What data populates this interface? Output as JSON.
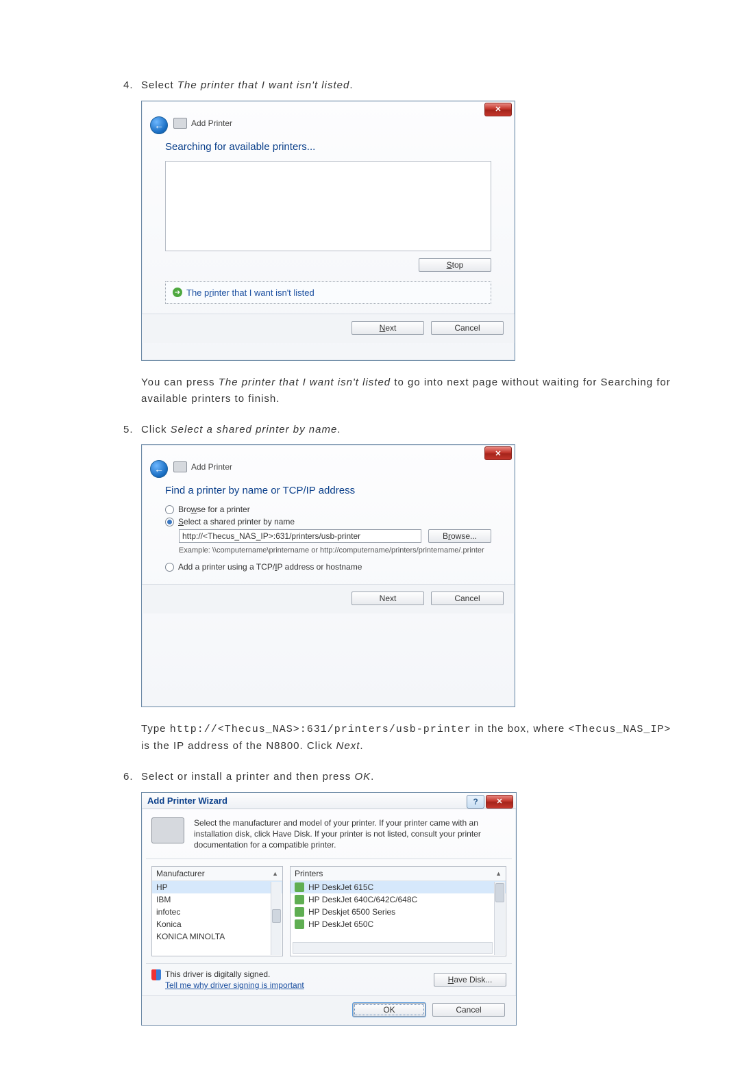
{
  "steps": {
    "s4": {
      "num": "4.",
      "pre": "Select ",
      "it": "The printer that I want isn't listed",
      "post": "."
    },
    "after4_a": "You can press ",
    "after4_it": "The printer that I want isn't listed",
    "after4_b": " to go into next page without waiting for Searching for available printers to finish.",
    "s5": {
      "num": "5.",
      "pre": "Click ",
      "it": "Select a shared printer by name",
      "post": "."
    },
    "after5_a": "Type ",
    "after5_code": "http://<Thecus_NAS>:631/printers/usb-printer",
    "after5_b": " in the box, where ",
    "after5_code2": "<Thecus_NAS_IP>",
    "after5_c": " is the IP address of the N8800. Click ",
    "after5_it": "Next",
    "after5_d": ".",
    "s6": {
      "num": "6.",
      "text_a": "Select or install a printer and then press ",
      "it": "OK",
      "post": "."
    }
  },
  "dlg1": {
    "title": "Add Printer",
    "heading": "Searching for available printers...",
    "stop": "Stop",
    "not_listed": "The printer that I want isn't listed",
    "next": "Next",
    "cancel": "Cancel"
  },
  "dlg2": {
    "title": "Add Printer",
    "heading": "Find a printer by name or TCP/IP address",
    "r1": "Browse for a printer",
    "r2": "Select a shared printer by name",
    "value": "http://<Thecus_NAS_IP>:631/printers/usb-printer",
    "browse": "Browse...",
    "hint": "Example: \\\\computername\\printername or http://computername/printers/printername/.printer",
    "r3": "Add a printer using a TCP/IP address or hostname",
    "next": "Next",
    "cancel": "Cancel"
  },
  "dlg3": {
    "title": "Add Printer Wizard",
    "desc": "Select the manufacturer and model of your printer. If your printer came with an installation disk, click Have Disk. If your printer is not listed, consult your printer documentation for a compatible printer.",
    "col1": "Manufacturer",
    "col2": "Printers",
    "m": [
      "HP",
      "IBM",
      "infotec",
      "Konica",
      "KONICA MINOLTA"
    ],
    "p": [
      "HP DeskJet 615C",
      "HP DeskJet 640C/642C/648C",
      "HP Deskjet 6500 Series",
      "HP DeskJet 650C"
    ],
    "signed": "This driver is digitally signed.",
    "whylink": "Tell me why driver signing is important",
    "havedisk": "Have Disk...",
    "ok": "OK",
    "cancel": "Cancel"
  }
}
